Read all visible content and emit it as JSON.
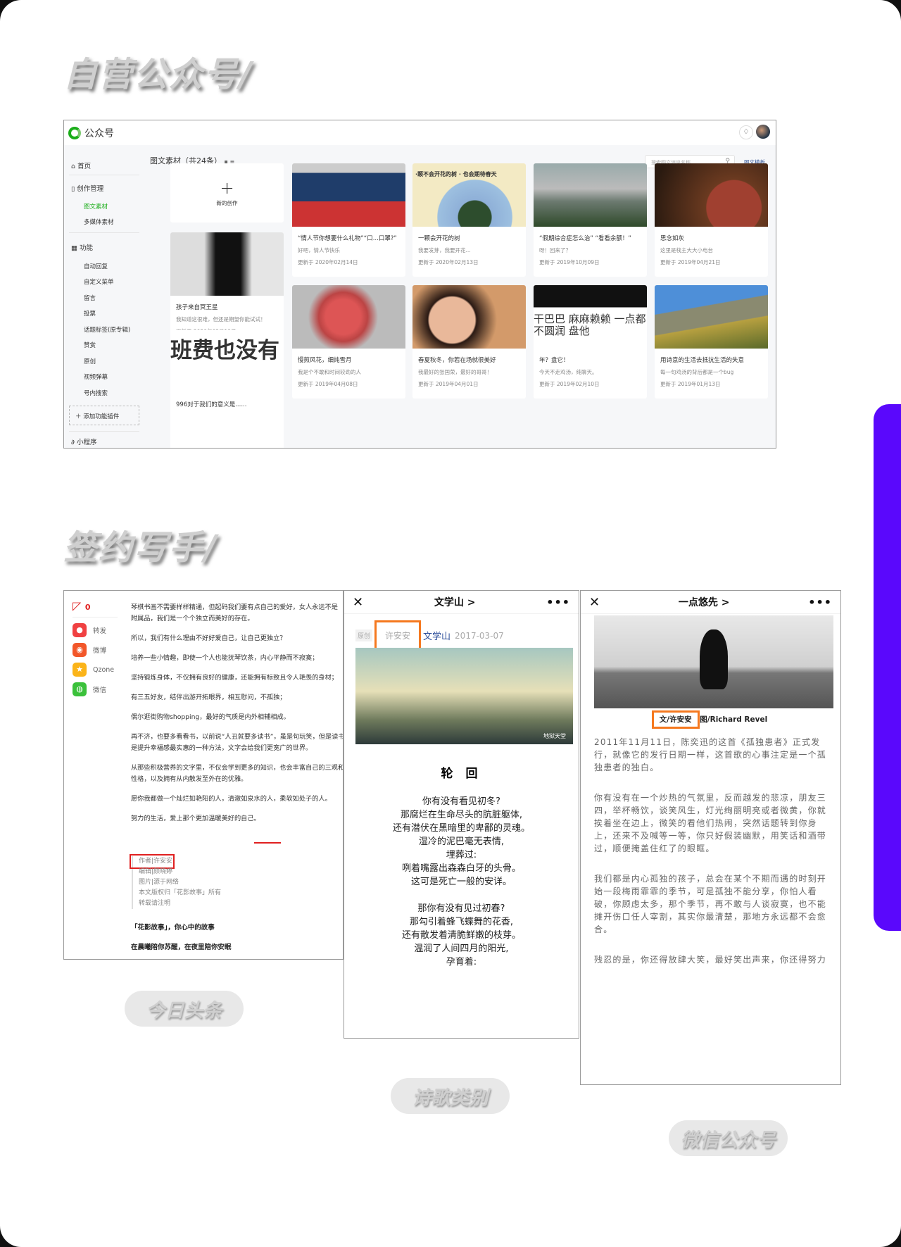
{
  "sections": {
    "official": "自营公众号/",
    "writer": "签约写手/"
  },
  "pills": [
    "今日头条",
    "诗歌类别",
    "微信公众号"
  ],
  "colors": {
    "accent": "#5a08fc",
    "green": "#1aad19",
    "orange": "#f5781e",
    "red": "#e02020"
  },
  "mp": {
    "title": "公众号",
    "sidebar": {
      "home": "首页",
      "create": "创作管理",
      "materials": "图文素材",
      "media": "多媒体素材",
      "features": "功能",
      "items": [
        "自动回复",
        "自定义菜单",
        "留言",
        "投票",
        "话题标签(原专辑)",
        "赞赏",
        "原创",
        "视频弹幕",
        "号内搜索"
      ],
      "add_plugin": "添加功能插件",
      "miniprogram": "小程序"
    },
    "content_title": "图文素材（共24条）",
    "search_placeholder": "搜索图文消息名称",
    "template_link": "图文模板",
    "new_label": "新的创作",
    "cards": [
      {
        "title": "孩子来自冥王星",
        "desc": "我知道这很难，但还是期望你能试试！",
        "date": "更新于 2020年02月19日"
      },
      {
        "title": "996对于我们的意义是......"
      },
      {
        "title": "“情人节你想要什么礼物”“口...口罩?”",
        "desc": "好吧，情人节快乐",
        "date": "更新于 2020年02月14日"
      },
      {
        "title": "一颗会开花的树",
        "desc": "我要发芽，我要开花...",
        "date": "更新于 2020年02月13日",
        "img_text": "·颗不会开花的树 · 也会期待春天"
      },
      {
        "title": "“假期综合症怎么治” “看看余额！”",
        "desc": "呀！回来了？",
        "date": "更新于 2019年10月09日"
      },
      {
        "title": "思念如灰",
        "desc": "这里是栈主大大小电台",
        "date": "更新于 2019年04月21日"
      },
      {
        "title": "慢煎风花，细炖雪月",
        "desc": "我是个不敢和时间较劲的人",
        "date": "更新于 2019年04月08日"
      },
      {
        "title": "春夏秋冬，你若在场就很美好",
        "desc": "我最好的张国荣，最好的哥哥！",
        "date": "更新于 2019年04月01日"
      },
      {
        "title": "年？盘它！",
        "desc": "今天不走鸡汤，纯聊天。",
        "date": "更新于 2019年02月10日",
        "img_text": "干巴巴 麻麻赖赖 一点都不圆润 盘他"
      },
      {
        "title": "用诗意的生活去抵抗生活的失意",
        "desc": "每一句鸡汤的背后都是一个bug",
        "date": "更新于 2019年01月13日"
      }
    ],
    "banner_text": "班费也没有"
  },
  "toutiao": {
    "comment_count": "0",
    "share": [
      "转发",
      "微博",
      "Qzone",
      "微信"
    ],
    "paragraphs": [
      "琴棋书画不需要样样精通，但起码我们要有点自己的爱好，女人永远不是附属品，我们是一个个独立而美好的存在。",
      "所以，我们有什么理由不好好爱自己，让自己更独立？",
      "培养一些小情趣，即使一个人也能抚琴饮茶，内心平静而不寂寞；",
      "坚持锻炼身体，不仅拥有良好的健康，还能拥有标致且令人艳羡的身材；",
      "有三五好友，结伴出游开拓眼界，相互慰问，不孤独；",
      "偶尔逛街购物shopping，最好的气质是内外相辅相成。",
      "再不济，也要多看看书，以前说“人丑就要多读书”，虽是句玩笑，但是读书是提升幸福感最实惠的一种方法，文字会给我们更宽广的世界。",
      "从那些积极营养的文字里，不仅会学到更多的知识，也会丰富自己的三观和性格，以及拥有从内散发至外在的优雅。",
      "愿你我都做一个灿烂如艳阳的人，清澈如泉水的人，柔软如处子的人。",
      "努力的生活，爱上那个更加温暖美好的自己。"
    ],
    "credits": [
      "作者|许安安",
      "编辑|颜晓婷",
      "图片|源于网络",
      "本文版权归「花影故事」所有",
      "转载请注明"
    ],
    "slogan1": "「花影故事」，你心中的故事",
    "slogan2": "在晨曦陪你苏醒，在夜里陪你安眠"
  },
  "poem_phone": {
    "account": "文学山 >",
    "original_tag": "原创",
    "author": "许安安",
    "account_name": "文学山",
    "date": "2017-03-07",
    "watermark": "地狱天堂",
    "title": "轮 回",
    "lines": [
      "你有没有看见初冬?",
      "那腐烂在生命尽头的肮脏躯体,",
      "还有潜伏在黑暗里的卑鄙的灵魂。",
      "湿冷的泥巴毫无表情,",
      "埋葬过:",
      "咧着嘴露出森森白牙的头骨。",
      "这可是死亡一般的安详。",
      "",
      "那你有没有见过初春?",
      "那勾引着蜂飞蝶舞的花香,",
      "还有散发着清脆鲜嫩的枝芽。",
      "温润了人间四月的阳光,",
      "孕育着:"
    ]
  },
  "wechat_phone": {
    "account": "一点悠先 >",
    "author_caption": "文/许安安",
    "photo_caption": "图/Richard Revel",
    "paragraphs": [
      "2011年11月11日，陈奕迅的这首《孤独患者》正式发行，就像它的发行日期一样，这首歌的心事注定是一个孤独患者的独白。",
      "你有没有在一个炒热的气氛里，反而越发的悲凉，朋友三四，举杯畅饮，谈笑风生，灯光绚丽明亮或者微黄，你就挨着坐在边上，微笑的看他们热闹，突然话题转到你身上，还来不及喊等一等，你只好假装幽默，用笑话和酒带过，顺便掩盖住红了的眼眶。",
      "我们都是内心孤独的孩子，总会在某个不期而遇的时刻开始一段梅雨霏霏的季节，可是孤独不能分享，你怕人看破，你顾虑太多，那个季节，再不敢与人谈寂寞，也不能摊开伤口任人宰割，其实你最清楚，那地方永远都不会愈合。",
      "残忍的是，你还得放肆大笑，最好笑出声来，你还得努力"
    ]
  }
}
